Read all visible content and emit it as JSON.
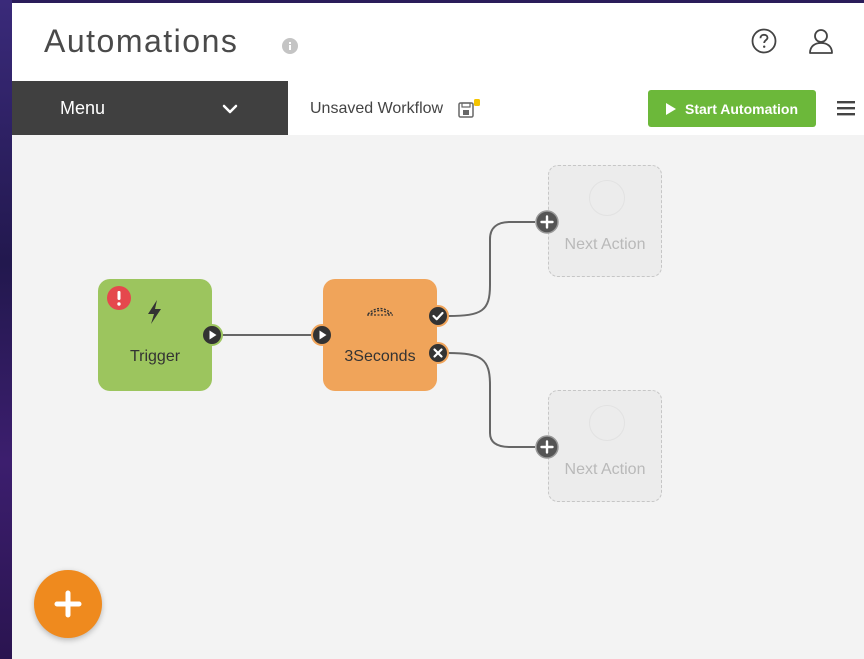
{
  "header": {
    "title": "Automations"
  },
  "toolbar": {
    "menu_label": "Menu",
    "workflow_name": "Unsaved Workflow",
    "start_label": "Start Automation"
  },
  "canvas": {
    "trigger": {
      "label": "Trigger",
      "status": "error"
    },
    "action": {
      "label": "3Seconds"
    },
    "next_actions": [
      {
        "label": "Next Action"
      },
      {
        "label": "Next Action"
      }
    ]
  },
  "icons": {
    "info": "info-icon",
    "help": "help-icon",
    "user": "user-icon",
    "menu_chevron": "chevron-down-icon",
    "save": "save-icon",
    "play": "play-icon",
    "hamburger": "hamburger-icon",
    "lightning": "lightning-icon",
    "fab": "plus-icon"
  },
  "colors": {
    "trigger": "#9cc55e",
    "action": "#f0a45a",
    "start_button": "#6cb83a",
    "fab": "#ef8a1e",
    "alert": "#e5484d"
  }
}
